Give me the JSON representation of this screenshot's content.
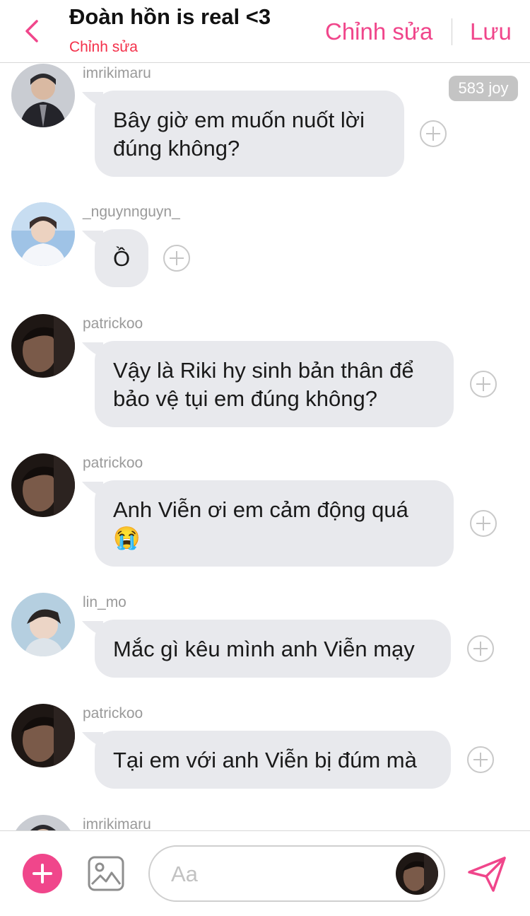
{
  "header": {
    "title": "Đoàn hồn is real <3",
    "subtitle": "Chỉnh sửa",
    "edit_label": "Chỉnh sửa",
    "save_label": "Lưu"
  },
  "badge": {
    "joy": "583 joy"
  },
  "messages": [
    {
      "username": "imrikimaru",
      "text": "Bây giờ em muốn nuốt lời đúng không?"
    },
    {
      "username": "_nguynnguyn_",
      "text": "Ồ"
    },
    {
      "username": "patrickoo",
      "text": "Vậy là Riki hy sinh bản thân để bảo vệ tụi em đúng không?"
    },
    {
      "username": "patrickoo",
      "text": "Anh Viễn ơi em cảm động quá 😭"
    },
    {
      "username": "lin_mo",
      "text": "Mắc gì kêu mình anh Viễn mạy"
    },
    {
      "username": "patrickoo",
      "text": "Tại em với anh Viễn bị đúm mà"
    },
    {
      "username": "imrikimaru",
      "text": ""
    }
  ],
  "composer": {
    "placeholder": "Aa"
  },
  "colors": {
    "accent": "#f0468b",
    "subtitle": "#f4304a",
    "bubble": "#e8e9ed"
  },
  "icons": [
    "chevron-left-icon",
    "plus-icon",
    "image-icon",
    "send-icon"
  ]
}
